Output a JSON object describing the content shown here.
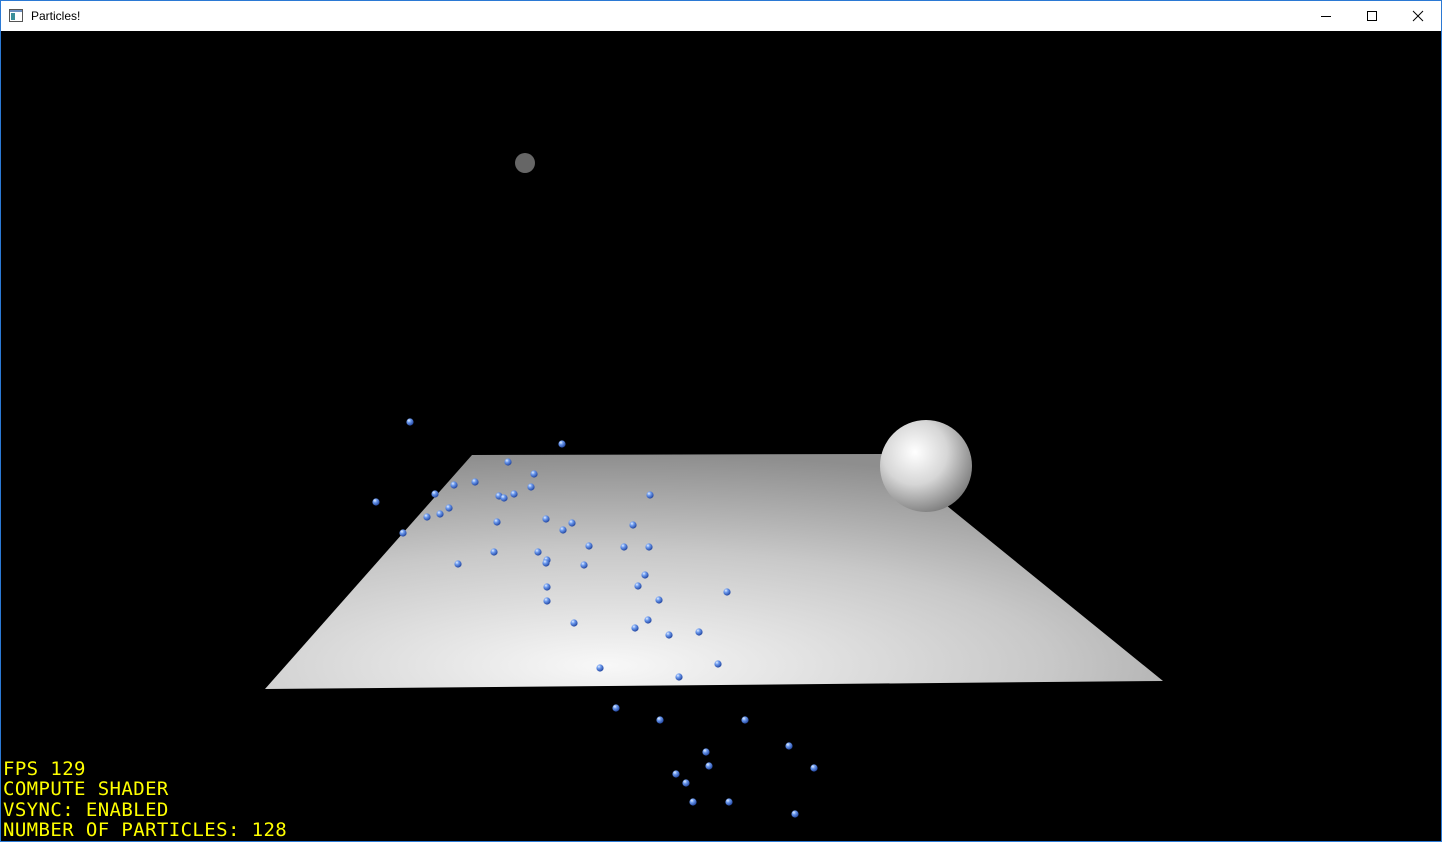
{
  "window": {
    "title": "Particles!",
    "icon": "app-window-icon",
    "controls": [
      "minimize-icon",
      "maximize-icon",
      "close-icon"
    ]
  },
  "hud": {
    "fps": "FPS 129",
    "mode": "COMPUTE SHADER",
    "vsync": "VSYNC: ENABLED",
    "particles": "NUMBER OF PARTICLES: 128"
  },
  "colors": {
    "hud_text": "#ffff00",
    "background": "#000000",
    "particle": "#4a7fe0",
    "plane": "#cfcfcf"
  }
}
